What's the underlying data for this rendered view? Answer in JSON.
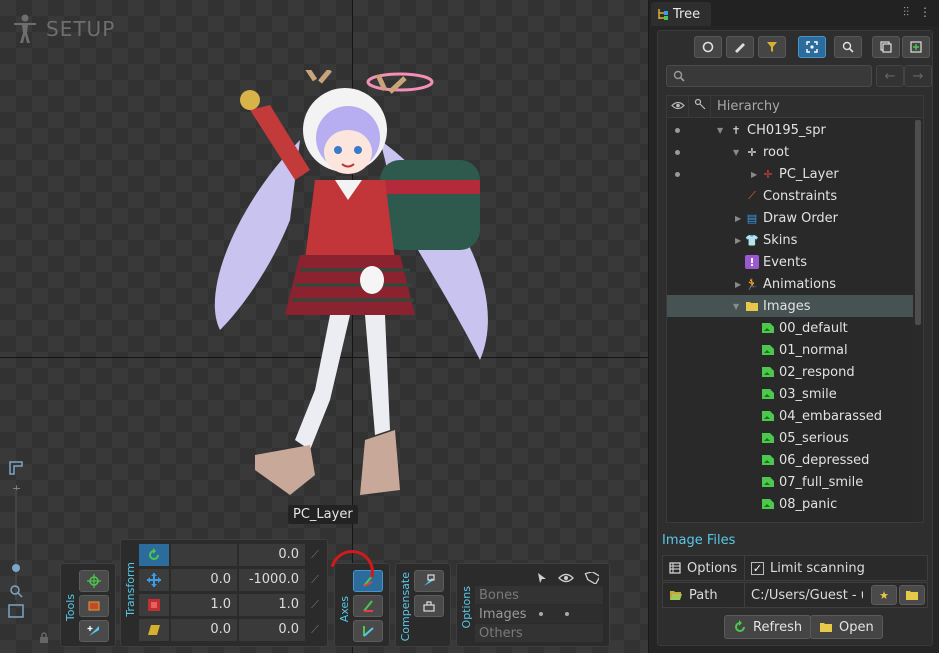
{
  "viewport": {
    "mode_label": "SETUP",
    "bone_label": "PC_Layer"
  },
  "toolbar": {
    "tools_label": "Tools",
    "transform_label": "Transform",
    "axes_label": "Axes",
    "compensate_label": "Compensate",
    "options_label": "Options",
    "rotate": {
      "value": "0.0"
    },
    "translate": {
      "x": "0.0",
      "y": "-1000.0"
    },
    "scale": {
      "x": "1.0",
      "y": "1.0"
    },
    "shear": {
      "x": "0.0",
      "y": "0.0"
    },
    "options_rows": [
      "Bones",
      "Images",
      "Others"
    ]
  },
  "tree_panel": {
    "tab_title": "Tree",
    "hierarchy_header": "Hierarchy",
    "nodes": [
      {
        "label": "CH0195_spr"
      },
      {
        "label": "root"
      },
      {
        "label": "PC_Layer"
      },
      {
        "label": "Constraints"
      },
      {
        "label": "Draw Order"
      },
      {
        "label": "Skins"
      },
      {
        "label": "Events"
      },
      {
        "label": "Animations"
      },
      {
        "label": "Images"
      },
      {
        "label": "00_default"
      },
      {
        "label": "01_normal"
      },
      {
        "label": "02_respond"
      },
      {
        "label": "03_smile"
      },
      {
        "label": "04_embarassed"
      },
      {
        "label": "05_serious"
      },
      {
        "label": "06_depressed"
      },
      {
        "label": "07_full_smile"
      },
      {
        "label": "08_panic"
      }
    ],
    "image_files": {
      "title": "Image Files",
      "options_label": "Options",
      "limit_scanning_label": "Limit scanning",
      "limit_scanning_checked": true,
      "path_label": "Path",
      "path_value": "C:/Users/Guest - us",
      "refresh_label": "Refresh",
      "open_label": "Open"
    }
  },
  "colors": {
    "accent": "#2c6c9c",
    "section_title": "#59c8e8",
    "selected_row": "#475253"
  }
}
